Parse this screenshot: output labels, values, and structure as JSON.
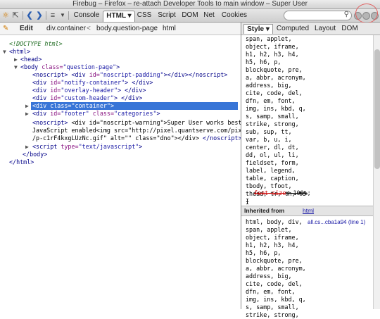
{
  "window": {
    "title": "Firebug – Firefox – re-attach Developer Tools to main window – Super User"
  },
  "toolbar": {
    "tabs": [
      {
        "label": "Console"
      },
      {
        "label": "HTML ▾"
      },
      {
        "label": "CSS"
      },
      {
        "label": "Script"
      },
      {
        "label": "DOM"
      },
      {
        "label": "Net"
      },
      {
        "label": "Cookies"
      }
    ],
    "search_placeholder": "",
    "icons": [
      "firebug-icon",
      "inspect-icon",
      "back-icon",
      "forward-icon",
      "menu-icon",
      "dropdown-icon",
      "search-icon",
      "minimize-icon",
      "detach-icon",
      "close-icon"
    ]
  },
  "breadcrumb": {
    "edit_label": "Edit",
    "items": [
      "div.container",
      "body.question-page",
      "html"
    ],
    "separator": "<"
  },
  "html_tree": {
    "lines": [
      {
        "t1": "<!DOCTYPE html>"
      },
      {
        "t1": "<html>"
      },
      {
        "t1": "<head>"
      },
      {
        "t1": "<body ",
        "a1": "class=",
        "v1": "\"question-page\"",
        "t2": ">"
      },
      {
        "t1": "<noscript>",
        "x1": " ",
        "t2": "<div ",
        "a1": "id=",
        "v1": "\"noscript-padding\"",
        "t3": "></div>",
        "t4": "</noscript>"
      },
      {
        "t1": "<div ",
        "a1": "id=",
        "v1": "\"notify-container\"",
        "t2": "> </div>"
      },
      {
        "t1": "<div ",
        "a1": "id=",
        "v1": "\"overlay-header\"",
        "t2": "> </div>"
      },
      {
        "t1": "<div ",
        "a1": "id=",
        "v1": "\"custom-header\"",
        "t2": "> </div>"
      },
      {
        "t1": "<div ",
        "a1": "class=",
        "v1": "\"container\"",
        "t2": ">"
      },
      {
        "t1": "<div ",
        "a1": "id=",
        "v1": "\"footer\"",
        "a2": " class=",
        "v2": "\"categories\"",
        "t2": ">"
      },
      {
        "t1": "<noscript>",
        "x1": " <div id=\"noscript-warning\">Super User works best with"
      },
      {
        "x1": "JavaScript enabled<img src=\"http://pixel.quantserve.com/pixel"
      },
      {
        "x1": "/p-c1rF4kxgLUzNc.gif\" alt=\"\" class=\"dno\"></div> ",
        "t1": "</noscript>"
      },
      {
        "t1": "<script ",
        "a1": "type=",
        "v1": "\"text/javascript\"",
        "t2": ">"
      },
      {
        "t1": "</body>"
      },
      {
        "t1": "</html>"
      }
    ]
  },
  "style_panel": {
    "tabs": [
      {
        "label": "Style ▾"
      },
      {
        "label": "Computed"
      },
      {
        "label": "Layout"
      },
      {
        "label": "DOM"
      }
    ],
    "rule1_lines": [
      "span, applet,",
      "object, iframe,",
      "h1, h2, h3, h4,",
      "h5, h6, p,",
      "blockquote, pre,",
      "a, abbr, acronym,",
      "address, big,",
      "cite, code, del,",
      "dfn, em, font,",
      "img, ins, kbd, q,",
      "s, samp, small,",
      "strike, strong,",
      "sub, sup, tt,",
      "var, b, u, i,",
      "center, dl, dt,",
      "dd, ol, ul, li,",
      "fieldset, form,",
      "label, legend,",
      "table, caption,",
      "tbody, tfoot,",
      "thead, tr, th, td",
      "{"
    ],
    "rule1_prop_name": "font-size",
    "rule1_prop_value": "100%",
    "rule1_close": "}",
    "inherited_label": "Inherited from",
    "inherited_link": "html",
    "source_link": "all.cs...cba1a94 (line 1)",
    "rule2_lines": [
      "html, body, div,",
      "span, applet,",
      "object, iframe,",
      "h1, h2, h3, h4,",
      "h5, h6, p,",
      "blockquote, pre,",
      "a, abbr, acronym,",
      "address, big,",
      "cite, code, del,",
      "dfn, em, font,",
      "img, ins, kbd, q,",
      "s, samp, small,",
      "strike, strong,"
    ]
  }
}
